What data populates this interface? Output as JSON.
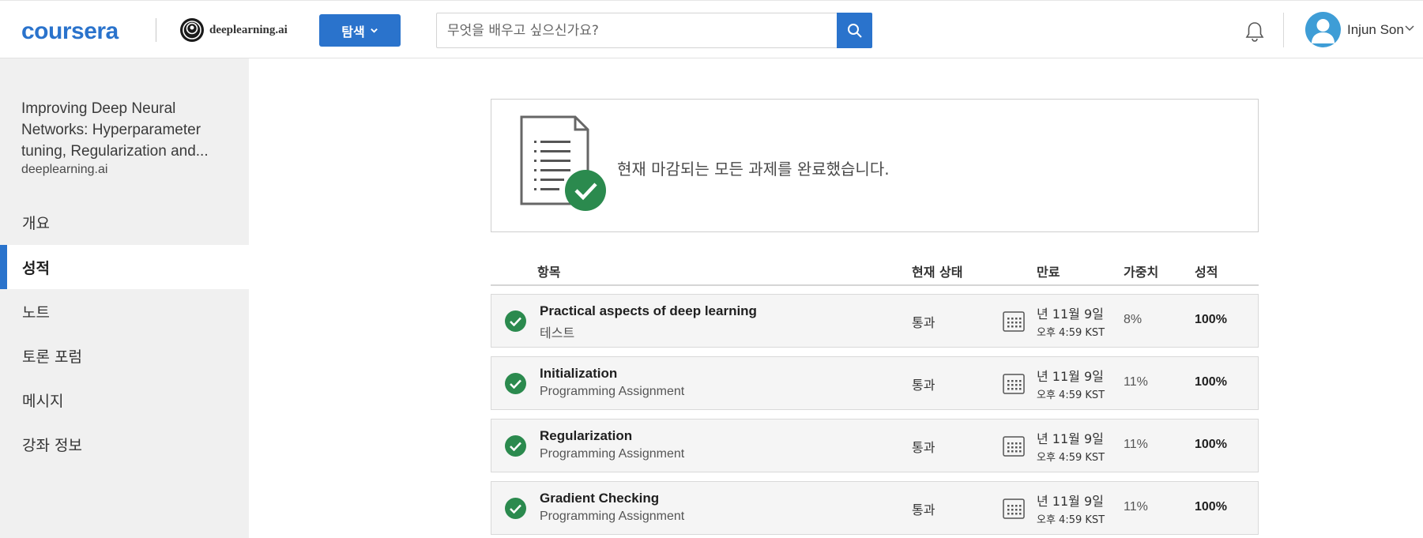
{
  "header": {
    "logo": "coursera",
    "partner_logo": "deeplearning.ai",
    "explore_label": "탐색",
    "search_placeholder": "무엇을 배우고 싶으신가요?",
    "user_name": "Injun Son",
    "accent_color": "#2a73cc"
  },
  "sidebar": {
    "course_title": "Improving Deep Neural Networks: Hyperparameter tuning, Regularization and...",
    "course_org": "deeplearning.ai",
    "items": [
      {
        "label": "개요",
        "active": false
      },
      {
        "label": "성적",
        "active": true
      },
      {
        "label": "노트",
        "active": false
      },
      {
        "label": "토론 포럼",
        "active": false
      },
      {
        "label": "메시지",
        "active": false
      },
      {
        "label": "강좌 정보",
        "active": false
      }
    ]
  },
  "banner": {
    "icon": "document-check-icon",
    "message": "현재 마감되는 모든 과제를 완료했습니다."
  },
  "table": {
    "headers": {
      "item": "항목",
      "status": "현재 상태",
      "due": "만료",
      "weight": "가중치",
      "grade": "성적"
    },
    "rows": [
      {
        "title": "Practical aspects of deep learning",
        "type": "테스트",
        "status": "통과",
        "date": "년 11월 9일",
        "time": "오후 4:59 KST",
        "weight": "8%",
        "grade": "100%"
      },
      {
        "title": "Initialization",
        "type": "Programming Assignment",
        "status": "통과",
        "date": "년 11월 9일",
        "time": "오후 4:59 KST",
        "weight": "11%",
        "grade": "100%"
      },
      {
        "title": "Regularization",
        "type": "Programming Assignment",
        "status": "통과",
        "date": "년 11월 9일",
        "time": "오후 4:59 KST",
        "weight": "11%",
        "grade": "100%"
      },
      {
        "title": "Gradient Checking",
        "type": "Programming Assignment",
        "status": "통과",
        "date": "년 11월 9일",
        "time": "오후 4:59 KST",
        "weight": "11%",
        "grade": "100%"
      }
    ]
  }
}
